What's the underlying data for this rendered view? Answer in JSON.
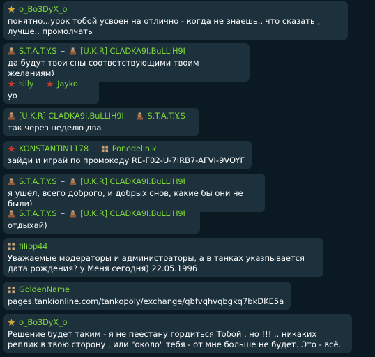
{
  "messages": [
    {
      "from": "o_Bo3DyX_o",
      "from_rank": "rank-star-icon",
      "to": null,
      "text": "понятно...урок тобой усвоен на отлично - когда не знаешь., что сказать , лучше.. промолчать"
    },
    {
      "from": "S.T.A.T.Y.S",
      "from_rank": "rank-marshal-icon",
      "to": "[U.K.R] CLADKA9I.BuLLIH9I",
      "to_rank": "rank-marshal-icon",
      "text": "да будут твои сны соответствующими твоим желаниям)"
    },
    {
      "from": "silly",
      "from_rank": "rank-red-star-icon",
      "to": "Jayko",
      "to_rank": "rank-red-star-icon",
      "text": "yo"
    },
    {
      "from": "[U.K.R] CLADKA9I.BuLLIH9I",
      "from_rank": "rank-marshal-icon",
      "to": "S.T.A.T.Y.S",
      "to_rank": "rank-marshal-icon",
      "text": "так через неделю два"
    },
    {
      "from": "KONSTANTIN1178",
      "from_rank": "rank-red-star-icon",
      "to": "Ponedelinik",
      "to_rank": "rank-dots-icon",
      "text": "зайди и играй по промокоду RE-F02-U-7IRB7-AFVI-9VOYF"
    },
    {
      "from": "S.T.A.T.Y.S",
      "from_rank": "rank-marshal-icon",
      "to": "[U.K.R] CLADKA9I.BuLLIH9I",
      "to_rank": "rank-marshal-icon",
      "text": "я ушёл, всего доброго, и добрых снов, какие бы они не были)"
    },
    {
      "from": "S.T.A.T.Y.S",
      "from_rank": "rank-marshal-icon",
      "to": "[U.K.R] CLADKA9I.BuLLIH9I",
      "to_rank": "rank-marshal-icon",
      "text": "отдыхай)"
    },
    {
      "from": "filipp44",
      "from_rank": "rank-dots-icon",
      "to": null,
      "text": "Уважаемые модераторы и администраторы, а в танках указпывается дата рождения? у Меня сегодня) 22.05.1996"
    },
    {
      "from": "GoldenName",
      "from_rank": "rank-dots-icon",
      "to": null,
      "text": "pages.tankionline.com/tankopoly/exchange/qbfvqhvqbgkq7bkDKE5a"
    },
    {
      "from": "o_Bo3DyX_o",
      "from_rank": "rank-star-icon",
      "to": null,
      "text": "Решение будет таким - я не пеестану гордиться Тобой , но !!! .. никаких реплик в твою сторону , или \"около\" тебя - от мне больше не будет. Это - всё."
    }
  ],
  "arrow": "–",
  "colors": {
    "background": "#0b1a22",
    "bubble": "#1d313d",
    "nickname": "#7fd53a",
    "text": "#ffffff"
  }
}
